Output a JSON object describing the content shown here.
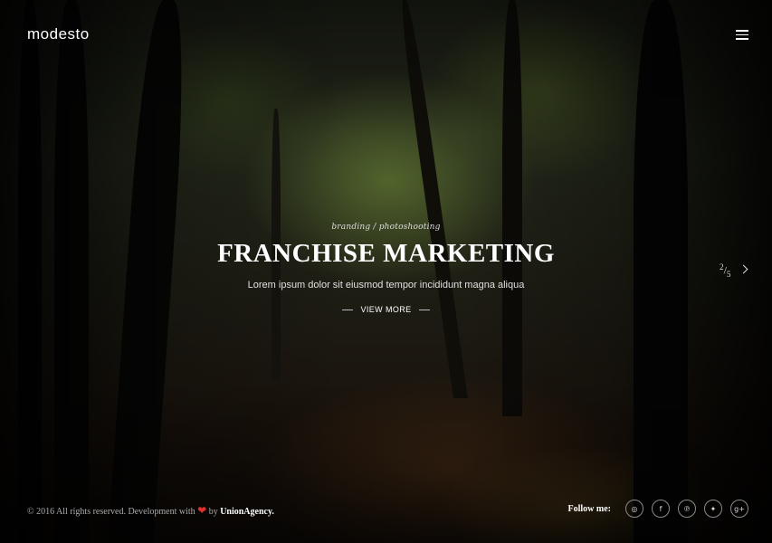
{
  "header": {
    "logo": "modesto",
    "menu_icon": "hamburger-menu-icon"
  },
  "slide": {
    "tags": "branding / photoshooting",
    "title": "FRANCHISE MARKETING",
    "description": "Lorem ipsum dolor sit eiusmod tempor incididunt magna aliqua",
    "cta_label": "VIEW MORE"
  },
  "pager": {
    "current": "2",
    "total": "5",
    "next_icon": "chevron-right-icon"
  },
  "footer": {
    "copyright": "© 2016 All rights reserved. Development with",
    "heart": "❤",
    "by": "by",
    "agency": "UnionAgency.",
    "heart_color": "#e03030"
  },
  "social": {
    "label": "Follow me:",
    "icons": [
      {
        "name": "instagram-icon",
        "glyph": "◎"
      },
      {
        "name": "facebook-icon",
        "glyph": "f"
      },
      {
        "name": "pinterest-icon",
        "glyph": "℗"
      },
      {
        "name": "twitter-icon",
        "glyph": "✦"
      },
      {
        "name": "google-plus-icon",
        "glyph": "g+"
      }
    ]
  }
}
